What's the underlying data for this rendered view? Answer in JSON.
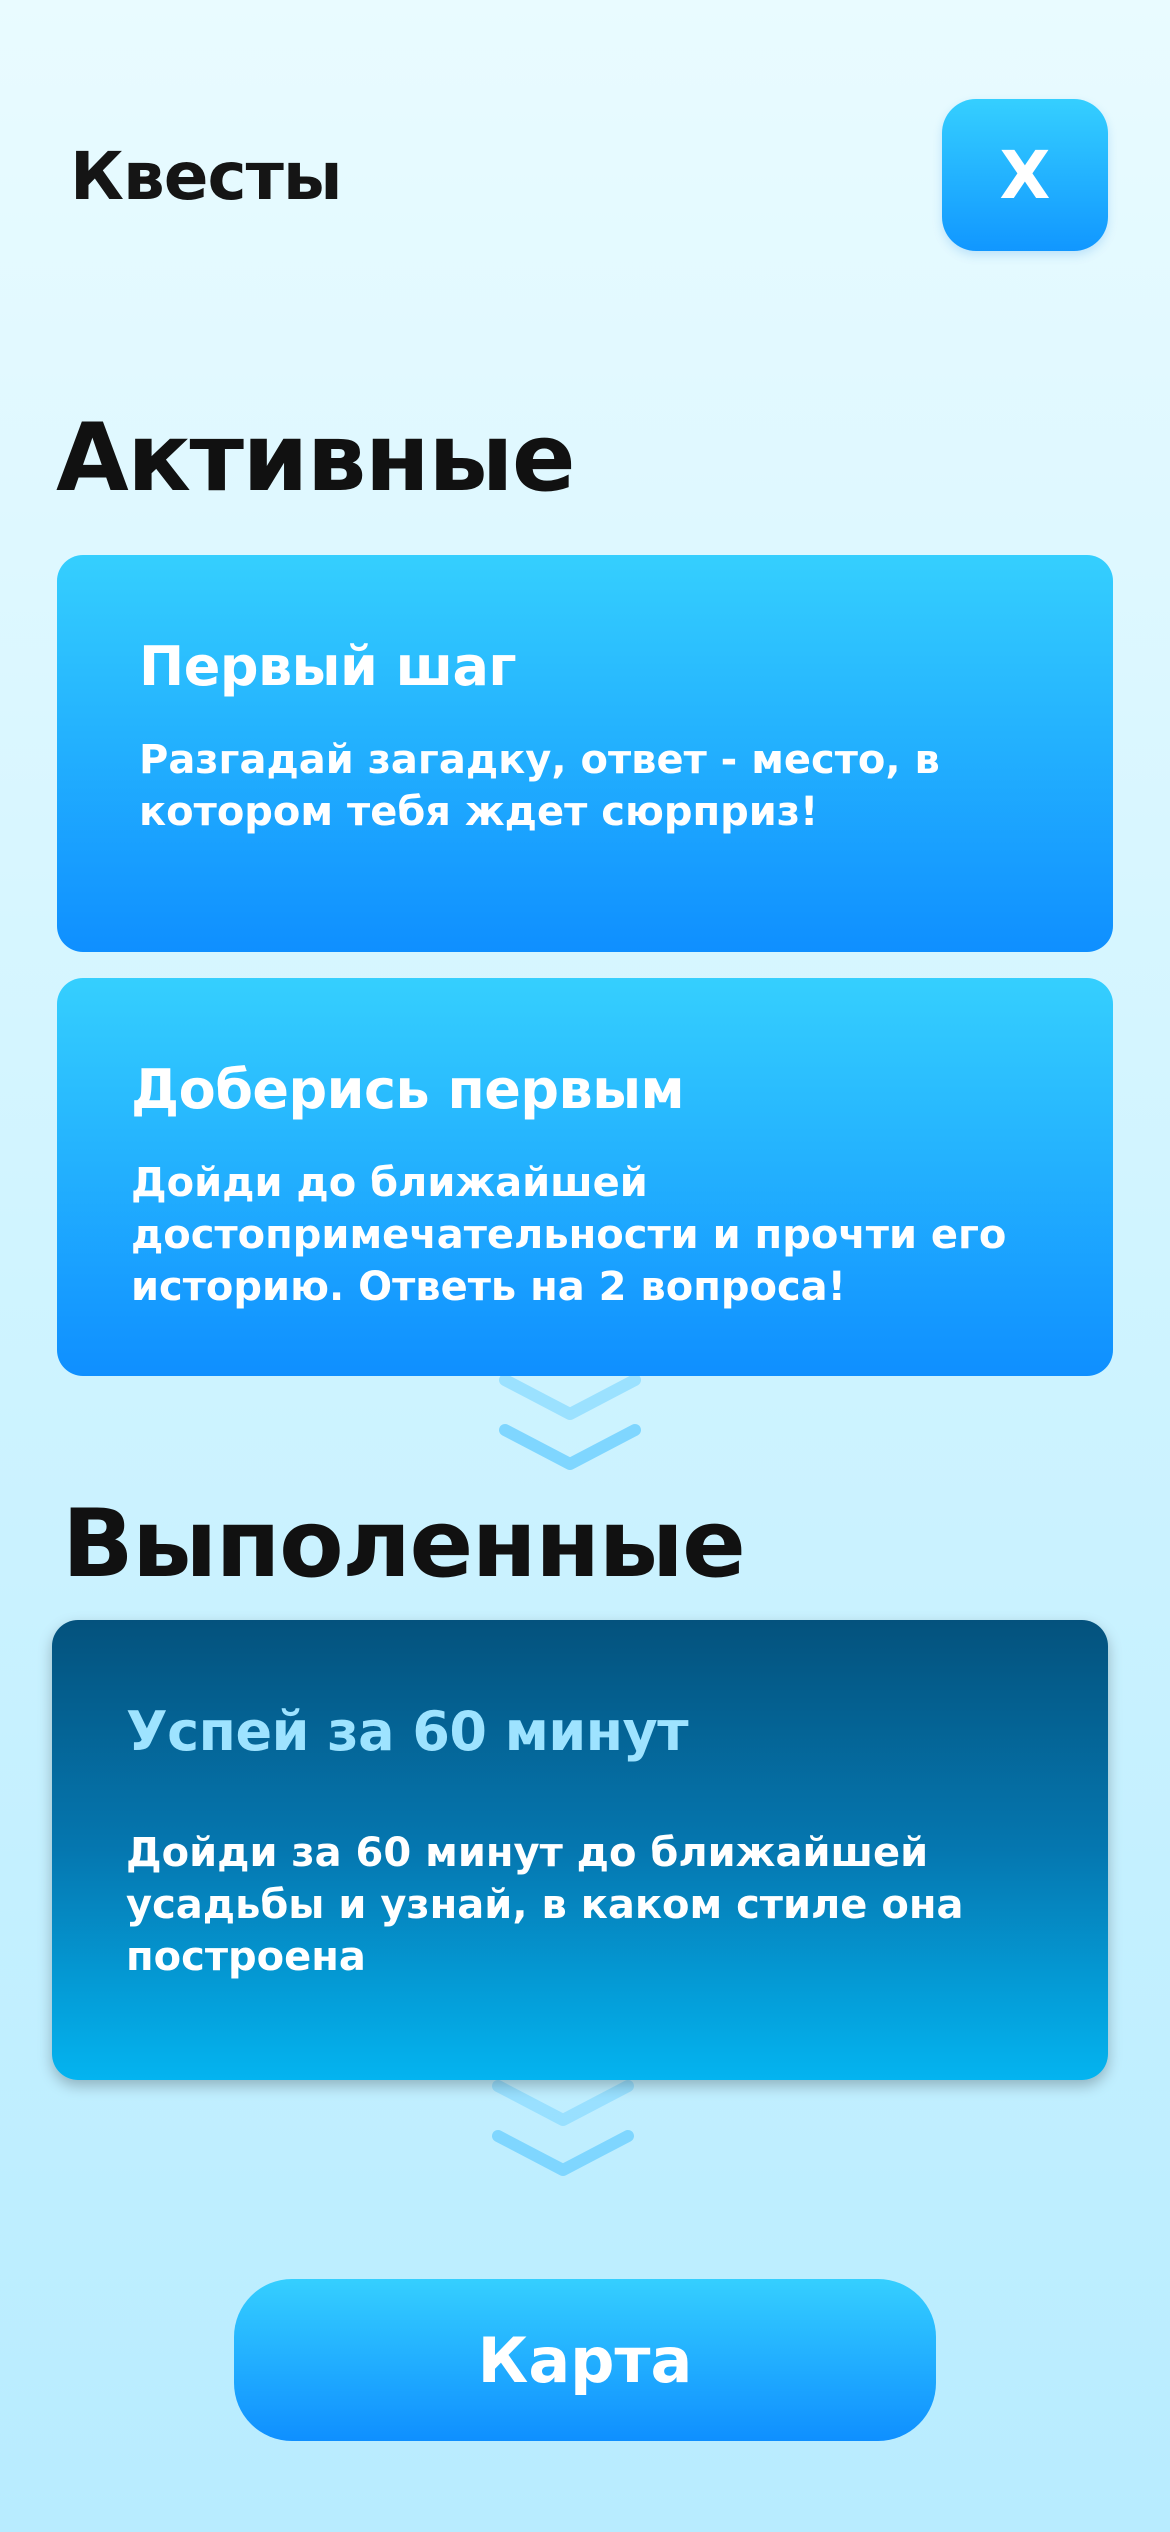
{
  "header": {
    "title": "Квесты",
    "close_label": "X"
  },
  "active_section": {
    "title": "Активные",
    "cards": [
      {
        "title": "Первый шаг",
        "text_lines": [
          "Разгадай загадку, ответ - место, в",
          "котором тебя ждет сюрприз!"
        ]
      },
      {
        "title": "Доберись первым",
        "text_lines": [
          "Дойди до ближайшей",
          "достопримечательности и прочти его",
          "историю. Ответь на 2 вопроса!"
        ]
      }
    ]
  },
  "done_section": {
    "title": "Выполенные",
    "cards": [
      {
        "title": "Успей за 60 минут",
        "text_lines": [
          "Дойди за 60 минут до ближайшей",
          "усадьбы и узнай, в каком стиле она",
          "построена"
        ]
      }
    ]
  },
  "footer": {
    "map_button_label": "Карта"
  },
  "icons": {
    "scroll_indicator": "double-chevron-down-icon"
  }
}
